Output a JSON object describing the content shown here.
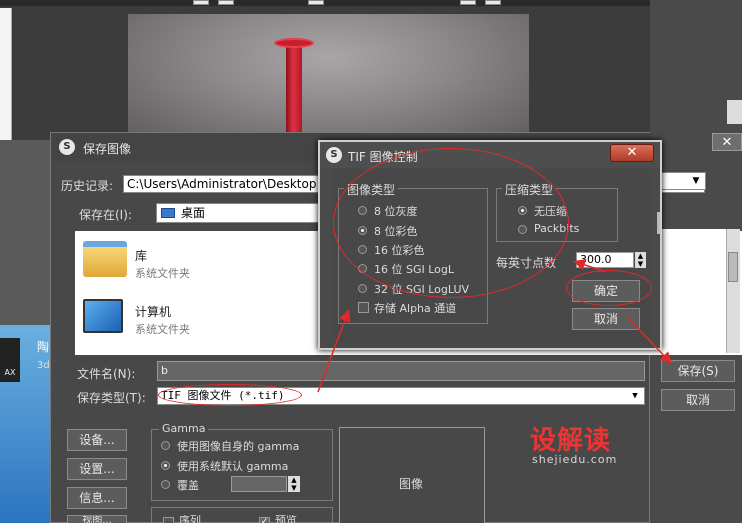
{
  "save_dialog": {
    "title": "保存图像",
    "history_label": "历史记录:",
    "history_value": "C:\\Users\\Administrator\\Desktop",
    "save_in_label": "保存在(I):",
    "save_in_value": "桌面",
    "files": [
      {
        "name": "库",
        "sub": "系统文件夹"
      },
      {
        "name": "计算机",
        "sub": "系统文件夹"
      }
    ],
    "filename_label": "文件名(N):",
    "filename_value": "b",
    "filetype_label": "保存类型(T):",
    "filetype_value": "TIF 图像文件 (*.tif)",
    "save_button": "保存(S)",
    "cancel_button": "取消",
    "devices_button": "设备...",
    "setup_button": "设置...",
    "info_button": "信息...",
    "view_button": "视图...",
    "gamma": {
      "title": "Gamma",
      "opt_own": "使用图像自身的 gamma",
      "opt_system": "使用系统默认 gamma",
      "opt_override": "覆盖"
    },
    "preview_label": "图像",
    "sequence_label": "序列",
    "preview_check_label": "预览"
  },
  "tif_dialog": {
    "title": "TIF 图像控制",
    "close_label": "✕",
    "image_type_title": "图像类型",
    "image_types": [
      "8 位灰度",
      "8 位彩色",
      "16 位彩色",
      "16 位 SGI LogL",
      "32 位 SGI LogLUV"
    ],
    "selected_image_type": "8 位彩色",
    "alpha_label": "存储 Alpha 通道",
    "compression_title": "压缩类型",
    "compression_types": [
      "无压缩",
      "Packbits"
    ],
    "selected_compression": "无压缩",
    "dpi_label": "每英寸点数",
    "dpi_value": "300.0",
    "ok_button": "确定",
    "cancel_button": "取消"
  },
  "desktop": {
    "icon_text": "AX",
    "label1": "陶",
    "label2": "3d"
  },
  "watermark": {
    "text": "设解读",
    "url": "shejiedu.com"
  },
  "colors": {
    "dialog_bg": "#484848",
    "annotation_red": "#e02a2a",
    "watermark_red": "#e33333"
  }
}
